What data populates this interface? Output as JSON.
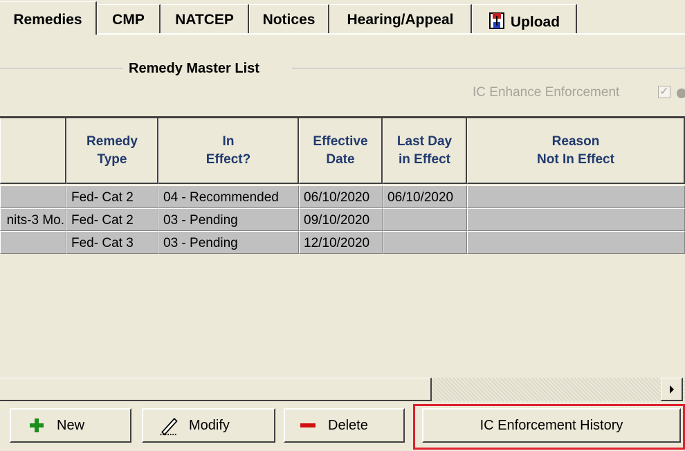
{
  "tabs": [
    {
      "label": "Remedies",
      "active": true
    },
    {
      "label": "CMP"
    },
    {
      "label": "NATCEP"
    },
    {
      "label": "Notices"
    },
    {
      "label": "Hearing/Appeal"
    },
    {
      "label": "Upload",
      "icon": "upload-icon"
    }
  ],
  "group": {
    "title": "Remedy Master List"
  },
  "enhance": {
    "label": "IC Enhance Enforcement",
    "checked": true
  },
  "table": {
    "columns": [
      "",
      "Remedy\nType",
      "In\nEffect?",
      "Effective\nDate",
      "Last Day\nin Effect",
      "Reason\nNot In Effect"
    ],
    "rows": [
      [
        "",
        "Fed- Cat 2",
        "04 - Recommended",
        "06/10/2020",
        "06/10/2020",
        ""
      ],
      [
        "nits-3 Mo.",
        "Fed- Cat 2",
        "03 - Pending",
        "09/10/2020",
        "",
        ""
      ],
      [
        "",
        "Fed- Cat 3",
        "03 - Pending",
        "12/10/2020",
        "",
        ""
      ]
    ]
  },
  "buttons": {
    "new": "New",
    "modify": "Modify",
    "delete": "Delete",
    "history": "IC Enforcement History"
  },
  "colors": {
    "highlight": "#e02030",
    "new_icon": "#1a8f1a",
    "delete_icon": "#d01010",
    "header_text": "#203a6e"
  }
}
